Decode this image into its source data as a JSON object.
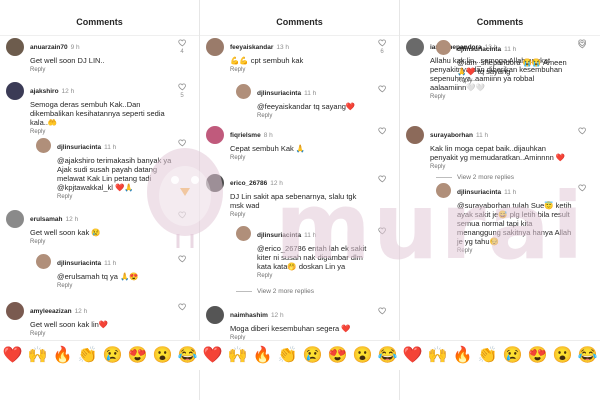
{
  "header_title": "Comments",
  "reply_label": "Reply",
  "panels": [
    {
      "comments": [
        {
          "user": "anuarzain70",
          "time": "9 h",
          "text": "Get well soon DJ LIN..",
          "likes": "4",
          "avatar": "#6d5c4d"
        },
        {
          "user": "ajakshiro",
          "time": "12 h",
          "text": "Semoga deras sembuh Kak..Dan dikembalikan kesihatannya seperti sedia kala..🤲",
          "likes": "5",
          "avatar": "#3b3b56"
        },
        {
          "user": "djlinsuriacinta",
          "time": "11 h",
          "text": "@ajakshiro terimakasih banyak ya Ajak sudi susah payah datang melawat Kak Lin petang tadi @kpjtawakkal_kl ❤️🙏",
          "mentions": [
            "@ajakshiro",
            "@kpjtawakkal_kl"
          ],
          "reply": true,
          "avatar": "#b08f7a"
        },
        {
          "user": "erulsamah",
          "time": "12 h",
          "text": "Get well soon kak 😢",
          "likes": "",
          "avatar": "#8a8a8a"
        },
        {
          "user": "djlinsuriacinta",
          "time": "11 h",
          "text": "@erulsamah tq ya 🙏😍",
          "mentions": [
            "@erulsamah"
          ],
          "reply": true,
          "avatar": "#b08f7a"
        },
        {
          "user": "amyleeazizan",
          "time": "12 h",
          "text": "Get well soon kak lin❤️",
          "likes": "",
          "avatar": "#7a5a50"
        }
      ],
      "more": null
    },
    {
      "comments": [
        {
          "user": "feeyaiskandar",
          "time": "13 h",
          "text": "💪💪 cpt sembuh kak",
          "likes": "6",
          "avatar": "#9a7b6a"
        },
        {
          "user": "djlinsuriacinta",
          "time": "11 h",
          "text": "@feeyaiskandar tq sayang❤️",
          "mentions": [
            "@feeyaiskandar"
          ],
          "reply": true,
          "avatar": "#b08f7a"
        },
        {
          "user": "fiqrielsme",
          "time": "8 h",
          "text": "Cepat sembuh Kak 🙏",
          "likes": "",
          "avatar": "#c05a7c"
        },
        {
          "user": "erico_26786",
          "time": "12 h",
          "text": "DJ Lin sakit apa sebenarnya, slalu tgk msk wad",
          "likes": "",
          "avatar": "#4a4a4a"
        },
        {
          "user": "djlinsuriacinta",
          "time": "11 h",
          "text": "@erico_26786 entah lah ek sakit kiter ni susah nak digambar dlm kata kata🤭 doskan Lin ya",
          "mentions": [
            "@erico_26786"
          ],
          "reply": true,
          "avatar": "#b08f7a"
        },
        {
          "user": "naimhashim",
          "time": "12 h",
          "text": "Moga diberi kesembuhan segera ❤️",
          "likes": "",
          "avatar": "#555555"
        }
      ],
      "more": "View 2 more replies"
    },
    {
      "comments": [
        {
          "user": "iam_shepandora",
          "time": "13 h",
          "text": "Allahu kak lin...semoga Allah angkat penyakitnya dan diberikan kesembuhan sepenuhnya..aamiinn ya robbal aalaamiinn🤍🤍",
          "likes": "",
          "avatar": "#6a6a6a"
        },
        {
          "user": "djlinsuriacinta",
          "time": "11 h",
          "text": "@iam_shepandora 😭😭 Ameen 🙏❤️ tq sayang",
          "mentions": [
            "@iam_shepandora"
          ],
          "reply": true,
          "avatar": "#b08f7a"
        },
        {
          "user": "surayaborhan",
          "time": "11 h",
          "text": "Kak lin moga cepat baik..dijauhkan penyakit yg memudaratkan..Aminnnn ❤️",
          "likes": "",
          "avatar": "#8c6a5a"
        },
        {
          "user": "djlinsuriacinta",
          "time": "11 h",
          "text": "@surayaborhan tulah Sue😇 ketih ayak sakit je😅 plg letih bila result semua normal tapi kita menanggung sakitnya hanya Allah je yg tahu😔",
          "mentions": [
            "@surayaborhan"
          ],
          "reply": true,
          "avatar": "#b08f7a"
        }
      ],
      "more": "View 2 more replies",
      "cut_user": "sofea_mina",
      "cut_time": "11 h"
    }
  ],
  "emoji_bar": [
    "❤️",
    "🙌",
    "🔥",
    "👏",
    "😢",
    "😍",
    "😮",
    "😂",
    "❤️",
    "🙌",
    "🔥",
    "👏",
    "😢",
    "😍",
    "😮",
    "😂",
    "❤️",
    "🙌",
    "🔥",
    "👏",
    "😢",
    "😍",
    "😮",
    "😂"
  ],
  "watermark": "murai",
  "colors": {
    "mention": "#3b5b94",
    "watermark": "#e1c8d7",
    "heart_red": "#d1243a"
  }
}
